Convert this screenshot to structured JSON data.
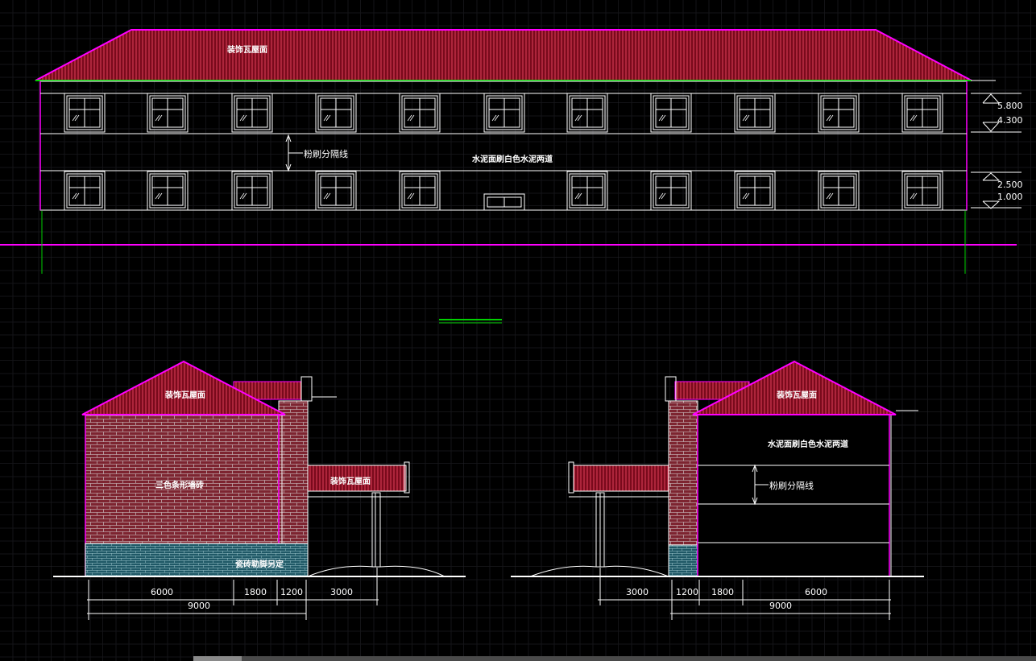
{
  "front_elevation": {
    "roof_label": "装饰瓦屋面",
    "wall_label": "水泥面刷白色水泥两道",
    "divider_label": "粉刷分隔线",
    "levels": [
      "5.800",
      "4.300",
      "2.500",
      "1.000"
    ]
  },
  "left_side_elevation": {
    "roof_label": "装饰瓦屋面",
    "canopy_label": "装饰瓦屋面",
    "wall_label": "三色条形墙砖",
    "base_label": "瓷砖勒脚另定",
    "dims_row1": [
      "6000",
      "1800",
      "1200",
      "3000"
    ],
    "dims_row2": [
      "9000"
    ]
  },
  "right_side_elevation": {
    "roof_label": "装饰瓦屋面",
    "wall_label": "水泥面刷白色水泥两道",
    "divider_label": "粉刷分隔线",
    "dims_row1": [
      "3000",
      "1200",
      "1800",
      "6000"
    ],
    "dims_row2": [
      "9000"
    ]
  },
  "colors": {
    "background": "#000000",
    "grid": "#2a2a2e",
    "magenta": "#ff00ff",
    "roof": "#8b0a1e",
    "roof_stripe": "#d0304a",
    "brick": "#8a2a36",
    "tile_base": "#2a6a7a",
    "green": "#00d000",
    "white": "#ffffff"
  }
}
